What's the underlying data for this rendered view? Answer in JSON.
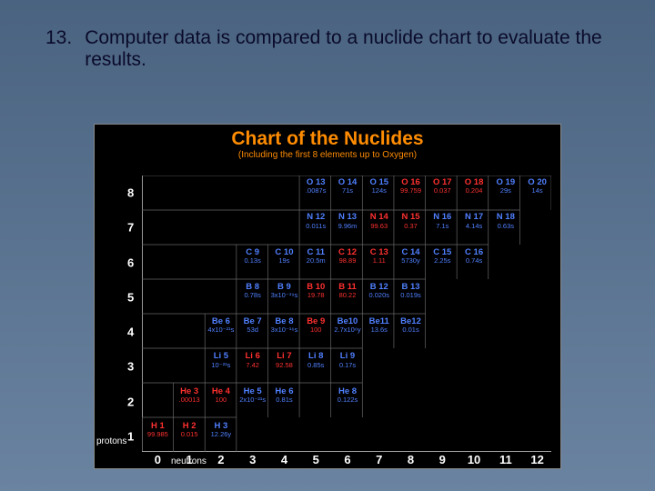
{
  "slide": {
    "number": "13.",
    "text": "Computer data is compared to a nuclide chart to evaluate the results."
  },
  "chart": {
    "title": "Chart of the Nuclides",
    "subtitle": "(Including the first 8 elements up to Oxygen)",
    "y_label": "protons",
    "x_label": "neutrons",
    "y_ticks": [
      "1",
      "2",
      "3",
      "4",
      "5",
      "6",
      "7",
      "8"
    ],
    "x_ticks": [
      "0",
      "1",
      "2",
      "3",
      "4",
      "5",
      "6",
      "7",
      "8",
      "9",
      "10",
      "11",
      "12"
    ]
  },
  "chart_data": {
    "type": "table",
    "title": "Chart of the Nuclides",
    "xlabel": "neutrons",
    "ylabel": "protons",
    "cells": [
      {
        "z": 1,
        "n": 0,
        "sym": "H 1",
        "val": "99.985",
        "c": "red"
      },
      {
        "z": 1,
        "n": 1,
        "sym": "H 2",
        "val": "0.015",
        "c": "red"
      },
      {
        "z": 1,
        "n": 2,
        "sym": "H 3",
        "val": "12.26y",
        "c": "blue"
      },
      {
        "z": 2,
        "n": 1,
        "sym": "He 3",
        "val": ".00013",
        "c": "red"
      },
      {
        "z": 2,
        "n": 2,
        "sym": "He 4",
        "val": "100",
        "c": "red"
      },
      {
        "z": 2,
        "n": 3,
        "sym": "He 5",
        "val": "2x10⁻²¹s",
        "c": "blue"
      },
      {
        "z": 2,
        "n": 4,
        "sym": "He 6",
        "val": "0.81s",
        "c": "blue"
      },
      {
        "z": 2,
        "n": 6,
        "sym": "He 8",
        "val": "0.122s",
        "c": "blue"
      },
      {
        "z": 3,
        "n": 2,
        "sym": "Li 5",
        "val": "10⁻²¹s",
        "c": "blue"
      },
      {
        "z": 3,
        "n": 3,
        "sym": "Li 6",
        "val": "7.42",
        "c": "red"
      },
      {
        "z": 3,
        "n": 4,
        "sym": "Li 7",
        "val": "92.58",
        "c": "red"
      },
      {
        "z": 3,
        "n": 5,
        "sym": "Li 8",
        "val": "0.85s",
        "c": "blue"
      },
      {
        "z": 3,
        "n": 6,
        "sym": "Li 9",
        "val": "0.17s",
        "c": "blue"
      },
      {
        "z": 4,
        "n": 2,
        "sym": "Be 6",
        "val": "4x10⁻²¹s",
        "c": "blue"
      },
      {
        "z": 4,
        "n": 3,
        "sym": "Be 7",
        "val": "53d",
        "c": "blue"
      },
      {
        "z": 4,
        "n": 4,
        "sym": "Be 8",
        "val": "3x10⁻¹⁶s",
        "c": "blue"
      },
      {
        "z": 4,
        "n": 5,
        "sym": "Be 9",
        "val": "100",
        "c": "red"
      },
      {
        "z": 4,
        "n": 6,
        "sym": "Be10",
        "val": "2.7x10⁶y",
        "c": "blue"
      },
      {
        "z": 4,
        "n": 7,
        "sym": "Be11",
        "val": "13.6s",
        "c": "blue"
      },
      {
        "z": 4,
        "n": 8,
        "sym": "Be12",
        "val": "0.01s",
        "c": "blue"
      },
      {
        "z": 5,
        "n": 3,
        "sym": "B 8",
        "val": "0.78s",
        "c": "blue"
      },
      {
        "z": 5,
        "n": 4,
        "sym": "B 9",
        "val": "3x10⁻¹⁹s",
        "c": "blue"
      },
      {
        "z": 5,
        "n": 5,
        "sym": "B 10",
        "val": "19.78",
        "c": "red"
      },
      {
        "z": 5,
        "n": 6,
        "sym": "B 11",
        "val": "80.22",
        "c": "red"
      },
      {
        "z": 5,
        "n": 7,
        "sym": "B 12",
        "val": "0.020s",
        "c": "blue"
      },
      {
        "z": 5,
        "n": 8,
        "sym": "B 13",
        "val": "0.019s",
        "c": "blue"
      },
      {
        "z": 6,
        "n": 3,
        "sym": "C 9",
        "val": "0.13s",
        "c": "blue"
      },
      {
        "z": 6,
        "n": 4,
        "sym": "C 10",
        "val": "19s",
        "c": "blue"
      },
      {
        "z": 6,
        "n": 5,
        "sym": "C 11",
        "val": "20.5m",
        "c": "blue"
      },
      {
        "z": 6,
        "n": 6,
        "sym": "C 12",
        "val": "98.89",
        "c": "red"
      },
      {
        "z": 6,
        "n": 7,
        "sym": "C 13",
        "val": "1.11",
        "c": "red"
      },
      {
        "z": 6,
        "n": 8,
        "sym": "C 14",
        "val": "5730y",
        "c": "blue"
      },
      {
        "z": 6,
        "n": 9,
        "sym": "C 15",
        "val": "2.25s",
        "c": "blue"
      },
      {
        "z": 6,
        "n": 10,
        "sym": "C 16",
        "val": "0.74s",
        "c": "blue"
      },
      {
        "z": 7,
        "n": 5,
        "sym": "N 12",
        "val": "0.011s",
        "c": "blue"
      },
      {
        "z": 7,
        "n": 6,
        "sym": "N 13",
        "val": "9.96m",
        "c": "blue"
      },
      {
        "z": 7,
        "n": 7,
        "sym": "N 14",
        "val": "99.63",
        "c": "red"
      },
      {
        "z": 7,
        "n": 8,
        "sym": "N 15",
        "val": "0.37",
        "c": "red"
      },
      {
        "z": 7,
        "n": 9,
        "sym": "N 16",
        "val": "7.1s",
        "c": "blue"
      },
      {
        "z": 7,
        "n": 10,
        "sym": "N 17",
        "val": "4.14s",
        "c": "blue"
      },
      {
        "z": 7,
        "n": 11,
        "sym": "N 18",
        "val": "0.63s",
        "c": "blue"
      },
      {
        "z": 8,
        "n": 5,
        "sym": "O 13",
        "val": ".0087s",
        "c": "blue"
      },
      {
        "z": 8,
        "n": 6,
        "sym": "O 14",
        "val": "71s",
        "c": "blue"
      },
      {
        "z": 8,
        "n": 7,
        "sym": "O 15",
        "val": "124s",
        "c": "blue"
      },
      {
        "z": 8,
        "n": 8,
        "sym": "O 16",
        "val": "99.759",
        "c": "red"
      },
      {
        "z": 8,
        "n": 9,
        "sym": "O 17",
        "val": "0.037",
        "c": "red"
      },
      {
        "z": 8,
        "n": 10,
        "sym": "O 18",
        "val": "0.204",
        "c": "red"
      },
      {
        "z": 8,
        "n": 11,
        "sym": "O 19",
        "val": "29s",
        "c": "blue"
      },
      {
        "z": 8,
        "n": 12,
        "sym": "O 20",
        "val": "14s",
        "c": "blue"
      }
    ]
  }
}
